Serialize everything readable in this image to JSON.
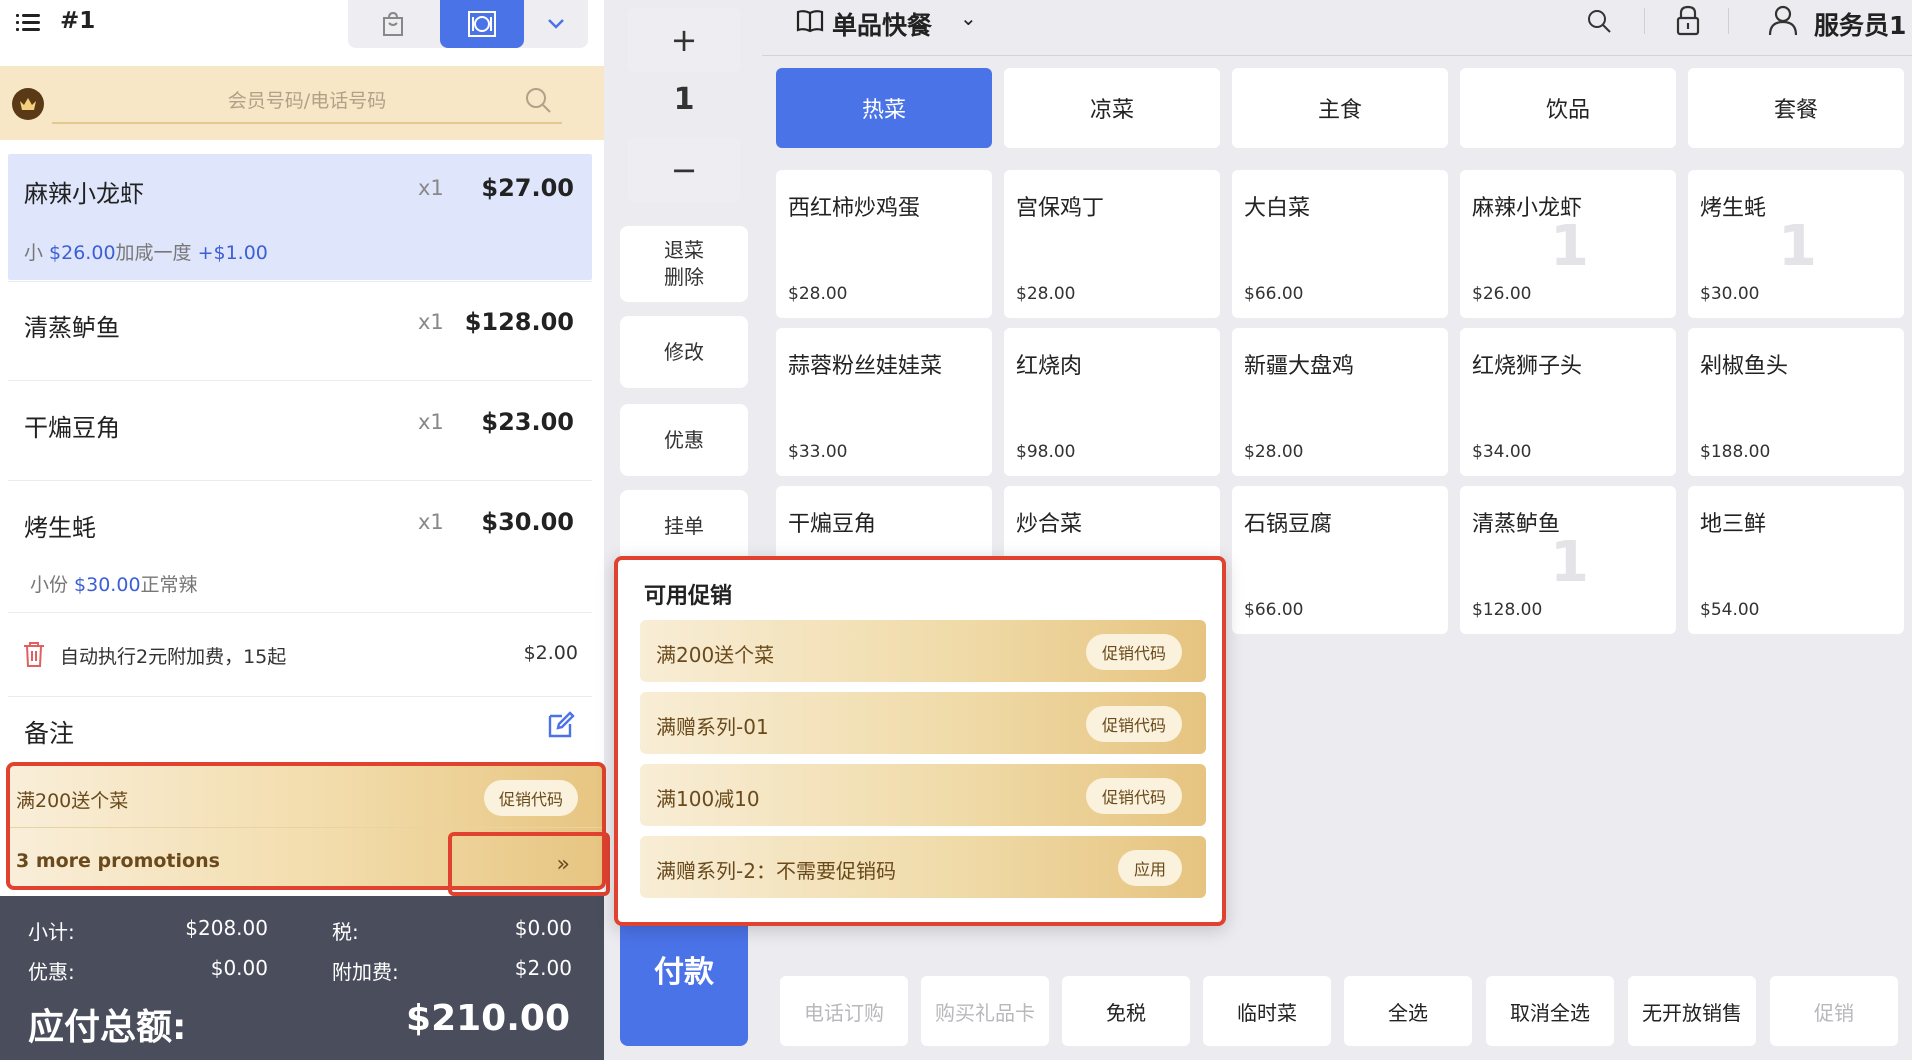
{
  "topbar": {
    "order_no": "#1"
  },
  "member": {
    "placeholder": "会员号码/电话号码"
  },
  "order_items": [
    {
      "name": "麻辣小龙虾",
      "qty": "x1",
      "price": "$27.00",
      "sub_prefix": "小 ",
      "sub_price": "$26.00",
      "sub_mid": "加咸一度 ",
      "sub_extra": "+$1.00"
    },
    {
      "name": "清蒸鲈鱼",
      "qty": "x1",
      "price": "$128.00"
    },
    {
      "name": "干煸豆角",
      "qty": "x1",
      "price": "$23.00"
    },
    {
      "name": "烤生蚝",
      "qty": "x1",
      "price": "$30.00",
      "sub_prefix": "小份 ",
      "sub_price": "$30.00",
      "sub_mid": "正常辣"
    }
  ],
  "fee": {
    "text": "自动执行2元附加费，15起",
    "amount": "$2.00"
  },
  "notes": {
    "label": "备注"
  },
  "promo_left": {
    "name": "满200送个菜",
    "chip": "促销代码",
    "more": "3 more promotions",
    "more_icon": "»"
  },
  "totals": {
    "subtotal_label": "小计:",
    "subtotal": "$208.00",
    "tax_label": "税:",
    "tax": "$0.00",
    "discount_label": "优惠:",
    "discount": "$0.00",
    "surcharge_label": "附加费:",
    "surcharge": "$2.00",
    "grand_label": "应付总额:",
    "grand": "$210.00"
  },
  "qty": {
    "plus": "+",
    "value": "1",
    "minus": "−"
  },
  "side_actions": {
    "refund_line1": "退菜",
    "refund_line2": "删除",
    "modify": "修改",
    "discount": "优惠",
    "hold": "挂单"
  },
  "pay": "付款",
  "header": {
    "menu_title": "单品快餐",
    "menu_chevron": "⌄",
    "user": "服务员1"
  },
  "categories": [
    "热菜",
    "凉菜",
    "主食",
    "饮品",
    "套餐"
  ],
  "products": [
    {
      "name": "西红柿炒鸡蛋",
      "price": "$28.00",
      "count": ""
    },
    {
      "name": "宫保鸡丁",
      "price": "$28.00",
      "count": ""
    },
    {
      "name": "大白菜",
      "price": "$66.00",
      "count": ""
    },
    {
      "name": "麻辣小龙虾",
      "price": "$26.00",
      "count": "1"
    },
    {
      "name": "烤生蚝",
      "price": "$30.00",
      "count": "1"
    },
    {
      "name": "蒜蓉粉丝娃娃菜",
      "price": "$33.00",
      "count": ""
    },
    {
      "name": "红烧肉",
      "price": "$98.00",
      "count": ""
    },
    {
      "name": "新疆大盘鸡",
      "price": "$28.00",
      "count": ""
    },
    {
      "name": "红烧狮子头",
      "price": "$34.00",
      "count": ""
    },
    {
      "name": "剁椒鱼头",
      "price": "$188.00",
      "count": ""
    },
    {
      "name": "干煸豆角",
      "price": "",
      "count": ""
    },
    {
      "name": "炒合菜",
      "price": "",
      "count": ""
    },
    {
      "name": "石锅豆腐",
      "price": "$66.00",
      "count": ""
    },
    {
      "name": "清蒸鲈鱼",
      "price": "$128.00",
      "count": "1"
    },
    {
      "name": "地三鲜",
      "price": "$54.00",
      "count": ""
    }
  ],
  "popup": {
    "title": "可用促销",
    "items": [
      {
        "name": "满200送个菜",
        "action": "促销代码"
      },
      {
        "name": "满赠系列-01",
        "action": "促销代码"
      },
      {
        "name": "满100减10",
        "action": "促销代码"
      },
      {
        "name": "满赠系列-2：不需要促销码",
        "action": "应用"
      }
    ]
  },
  "bottom_actions": [
    {
      "label": "电话订购",
      "enabled": false
    },
    {
      "label": "购买礼品卡",
      "enabled": false
    },
    {
      "label": "免税",
      "enabled": true
    },
    {
      "label": "临时菜",
      "enabled": true
    },
    {
      "label": "全选",
      "enabled": true
    },
    {
      "label": "取消全选",
      "enabled": true
    },
    {
      "label": "无开放销售",
      "enabled": true
    },
    {
      "label": "促销",
      "enabled": false
    }
  ],
  "colors": {
    "accent": "#4b73e8",
    "highlight": "#dfe6fb",
    "promo_border": "#e0422f",
    "gold": "#e7c582",
    "totals_bg": "#4a4d5c"
  },
  "icons": [
    "menu-icon",
    "bag-icon",
    "dine-in-icon",
    "chevron-down-icon",
    "crown-icon",
    "search-icon",
    "trash-icon",
    "edit-icon",
    "book-icon",
    "lock-icon",
    "user-icon"
  ]
}
